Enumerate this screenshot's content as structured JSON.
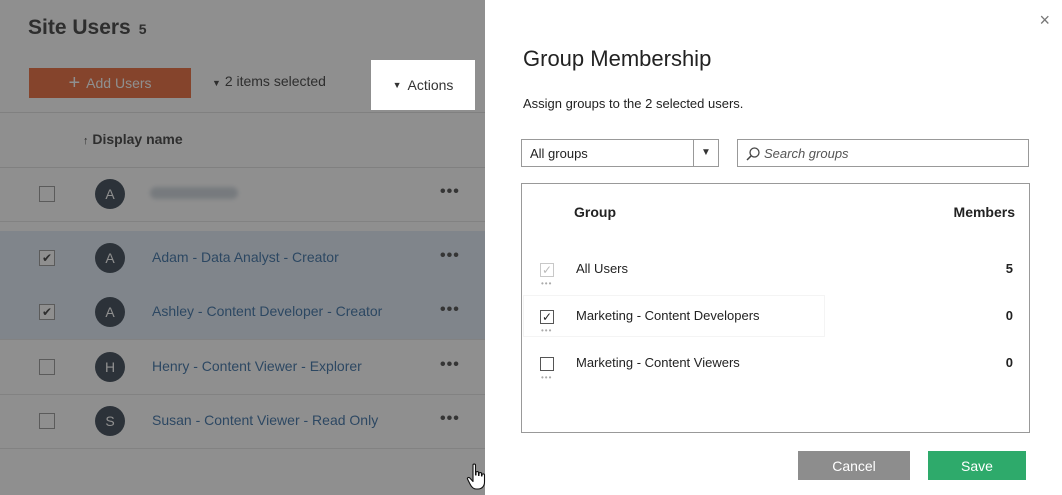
{
  "page": {
    "title": "Site Users",
    "count": "5",
    "add_users_label": "Add Users",
    "selected_text": "2 items selected",
    "actions_label": "Actions",
    "column_display_name": "Display name",
    "users": [
      {
        "initial": "A",
        "name": "",
        "checked": false,
        "blurred": true
      },
      {
        "initial": "A",
        "name": "Adam - Data Analyst - Creator",
        "checked": true,
        "blurred": false
      },
      {
        "initial": "A",
        "name": "Ashley - Content Developer - Creator",
        "checked": true,
        "blurred": false
      },
      {
        "initial": "H",
        "name": "Henry - Content Viewer - Explorer",
        "checked": false,
        "blurred": false
      },
      {
        "initial": "S",
        "name": "Susan - Content Viewer - Read Only",
        "checked": false,
        "blurred": false
      }
    ],
    "more_glyph": "•••"
  },
  "dialog": {
    "title": "Group Membership",
    "subtitle": "Assign groups to the 2 selected users.",
    "filter_value": "All groups",
    "search_placeholder": "Search groups",
    "col_group": "Group",
    "col_members": "Members",
    "groups": [
      {
        "name": "All Users",
        "members": "5",
        "checked": true,
        "disabled": true
      },
      {
        "name": "Marketing - Content Developers",
        "members": "0",
        "checked": true,
        "disabled": false
      },
      {
        "name": "Marketing - Content Viewers",
        "members": "0",
        "checked": false,
        "disabled": false
      }
    ],
    "cancel_label": "Cancel",
    "save_label": "Save",
    "close_glyph": "×"
  },
  "colors": {
    "accent_orange": "#e8541e",
    "save_green": "#2eaa6b",
    "link_blue": "#1f5c99",
    "row_selected": "#dce9f5"
  }
}
